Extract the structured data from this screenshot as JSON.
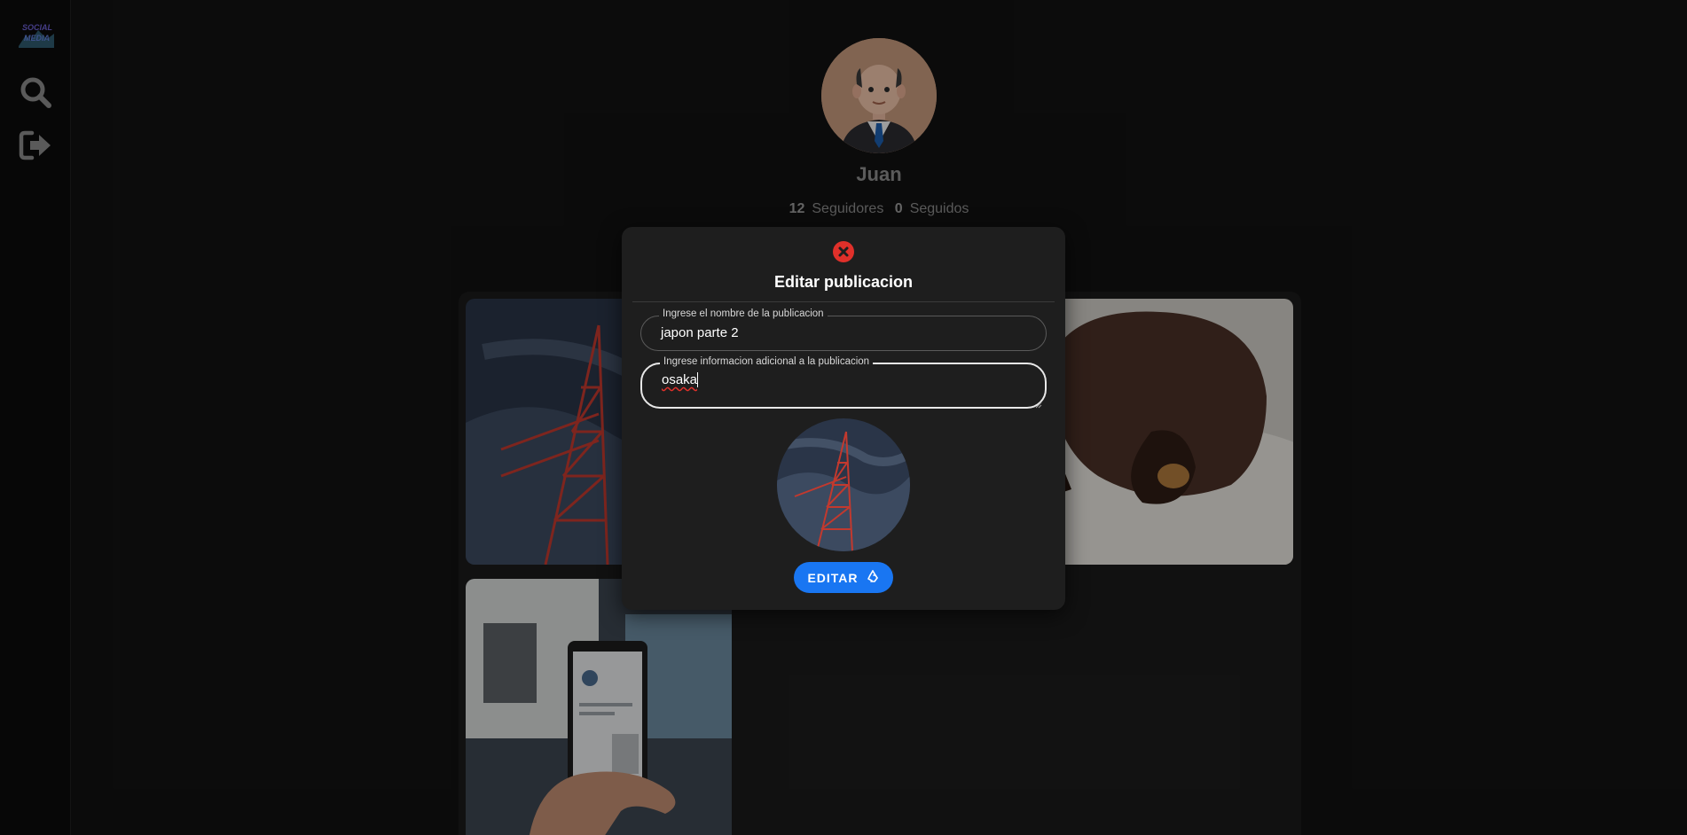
{
  "sidebar": {
    "logo_text": "SOCIAL MEDIA",
    "icons": [
      "logo",
      "search-icon",
      "logout-icon"
    ]
  },
  "profile": {
    "name": "Juan",
    "followers_count": "12",
    "followers_label": "Seguidores",
    "following_count": "0",
    "following_label": "Seguidos"
  },
  "modal": {
    "title": "Editar publicacion",
    "name_field": {
      "label": "Ingrese el nombre de la publicacion",
      "value": "japon parte 2"
    },
    "info_field": {
      "label": "Ingrese informacion adicional a la publicacion",
      "value": "osaka"
    },
    "submit_label": "EDITAR"
  },
  "colors": {
    "background": "#121212",
    "modal": "#1e1e1e",
    "accent": "#1976f2",
    "close": "#e0302a"
  }
}
